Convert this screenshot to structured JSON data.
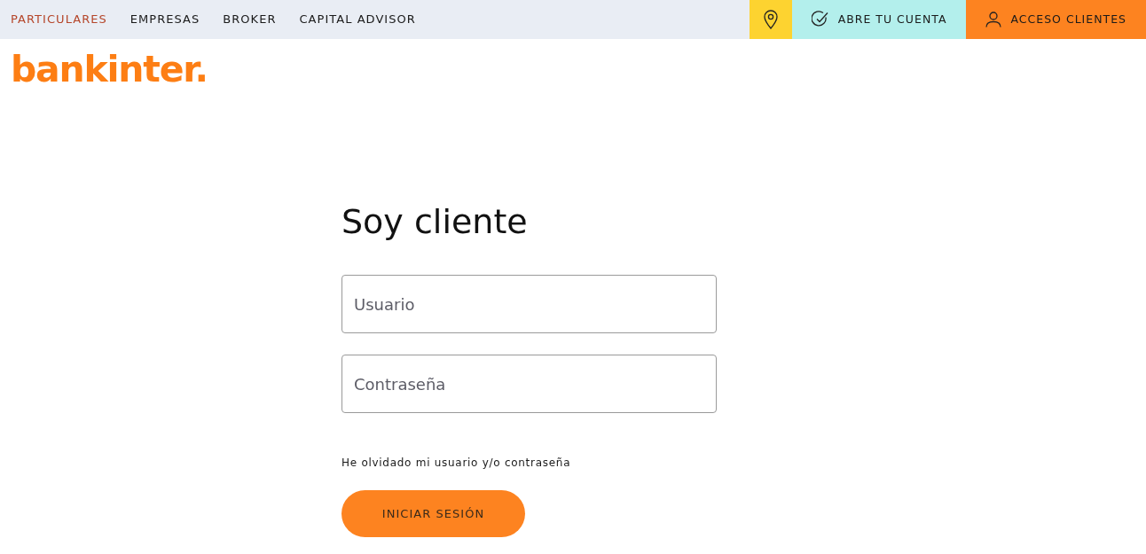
{
  "nav": [
    {
      "label": "PARTICULARES",
      "selected": true
    },
    {
      "label": "EMPRESAS",
      "selected": false
    },
    {
      "label": "BROKER",
      "selected": false
    },
    {
      "label": "CAPITAL ADVISOR",
      "selected": false
    }
  ],
  "actions": [
    {
      "kind": "location",
      "color": "#fdd330"
    },
    {
      "kind": "account",
      "label": "ABRE TU CUENTA",
      "color": "#b3efec"
    },
    {
      "kind": "login",
      "label": "ACCESO CLIENTES",
      "color": "#fd8320"
    }
  ],
  "logo": "bankinter.",
  "form": {
    "title": "Soy cliente",
    "fields": [
      {
        "placeholder": "Usuario"
      },
      {
        "placeholder": "Contraseña"
      }
    ],
    "forgot_link": "He olvidado mi usuario y/o contraseña",
    "submit": "INICIAR SESIÓN"
  }
}
